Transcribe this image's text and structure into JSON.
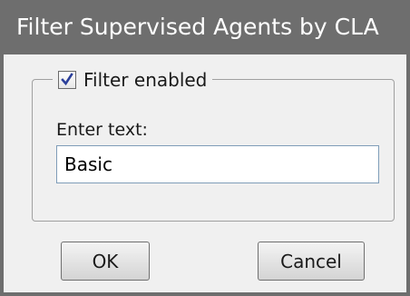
{
  "dialog": {
    "title": "Filter Supervised Agents by CLA",
    "filter_checkbox": {
      "label": "Filter enabled",
      "checked": true
    },
    "text_field": {
      "label": "Enter text:",
      "value": "Basic"
    },
    "buttons": {
      "ok_label": "OK",
      "cancel_label": "Cancel"
    }
  },
  "icons": {
    "checkbox_mark": "checkmark-icon"
  },
  "colors": {
    "titlebar": "#6e6e6e",
    "checkmark": "#2b3f9a",
    "dialog_bg": "#f0f0f0"
  }
}
